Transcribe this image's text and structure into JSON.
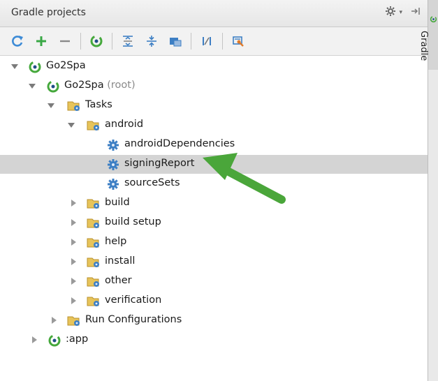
{
  "panel": {
    "title": "Gradle projects",
    "side_tab_label": "Gradle",
    "accent_green": "#4aa63a",
    "toolbar": [
      "refresh-icon",
      "add-icon",
      "remove-icon",
      "gradle-target-icon",
      "expand-all-icon",
      "collapse-all-icon",
      "attach-task-icon",
      "toggle-offline-icon",
      "settings-wrench-icon"
    ]
  },
  "tree": {
    "root": "Go2Spa",
    "subproject": "Go2Spa",
    "subproject_suffix": "(root)",
    "tasks": "Tasks",
    "android": "android",
    "t1": "androidDependencies",
    "t2": "signingReport",
    "t3": "sourceSets",
    "build": "build",
    "build_setup": "build setup",
    "help": "help",
    "install": "install",
    "other": "other",
    "verification": "verification",
    "run_configs": "Run Configurations",
    "app": ":app"
  }
}
